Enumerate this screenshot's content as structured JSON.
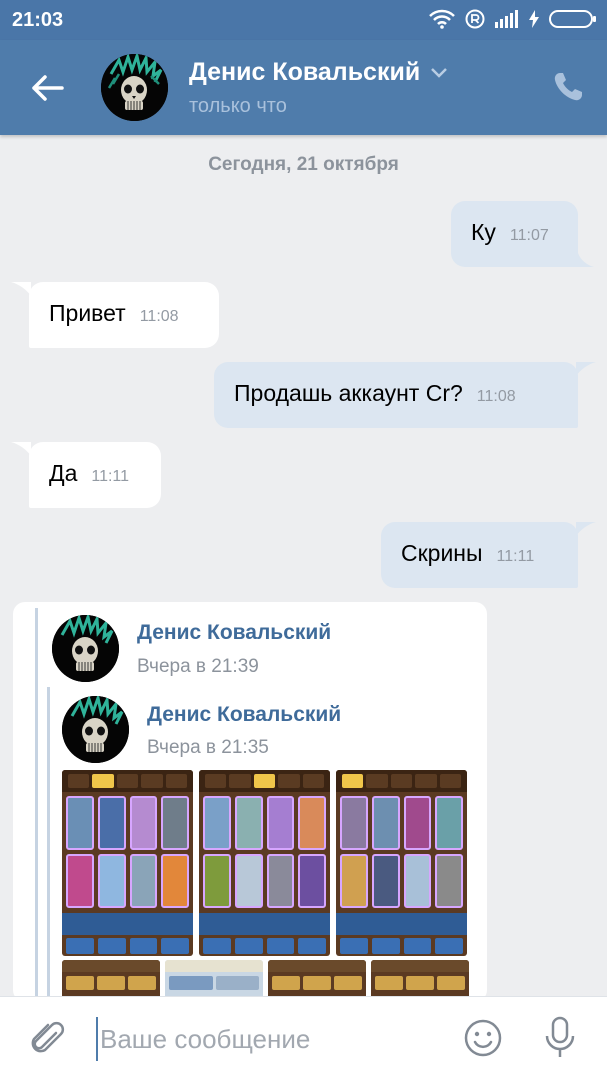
{
  "status_bar": {
    "time": "21:03",
    "icons": [
      "alarm-icon",
      "wifi-icon",
      "registered-icon",
      "signal-icon",
      "charging-icon",
      "battery-icon"
    ]
  },
  "header": {
    "name": "Денис Ковальский",
    "status": "только что",
    "icons": [
      "back-arrow-icon",
      "chevron-down-icon",
      "phone-icon"
    ]
  },
  "date_separator": "Сегодня, 21 октября",
  "messages": [
    {
      "direction": "out",
      "text": "Ку",
      "time": "11:07"
    },
    {
      "direction": "in",
      "text": "Привет",
      "time": "11:08"
    },
    {
      "direction": "out",
      "text": "Продашь аккаунт Cr?",
      "time": "11:08"
    },
    {
      "direction": "in",
      "text": "Да",
      "time": "11:11"
    },
    {
      "direction": "out",
      "text": "Скрины",
      "time": "11:11"
    }
  ],
  "forwarded": {
    "outer": {
      "author": "Денис Ковальский",
      "date": "Вчера в 21:39"
    },
    "inner": {
      "author": "Денис Ковальский",
      "date": "Вчера в 21:35"
    },
    "attachments": [
      "screenshot-1",
      "screenshot-2",
      "screenshot-3",
      "screenshot-4",
      "screenshot-5",
      "screenshot-6",
      "screenshot-7"
    ]
  },
  "composer": {
    "placeholder": "Ваше сообщение",
    "value": "",
    "icons": [
      "paperclip-icon",
      "emoji-icon",
      "microphone-icon"
    ]
  },
  "colors": {
    "header": "#4f7cab",
    "status_bar": "#4a76a8",
    "background": "#edeef0",
    "outgoing_bubble": "#dce6f1",
    "incoming_bubble": "#ffffff",
    "link_name": "#3f6b9a"
  }
}
